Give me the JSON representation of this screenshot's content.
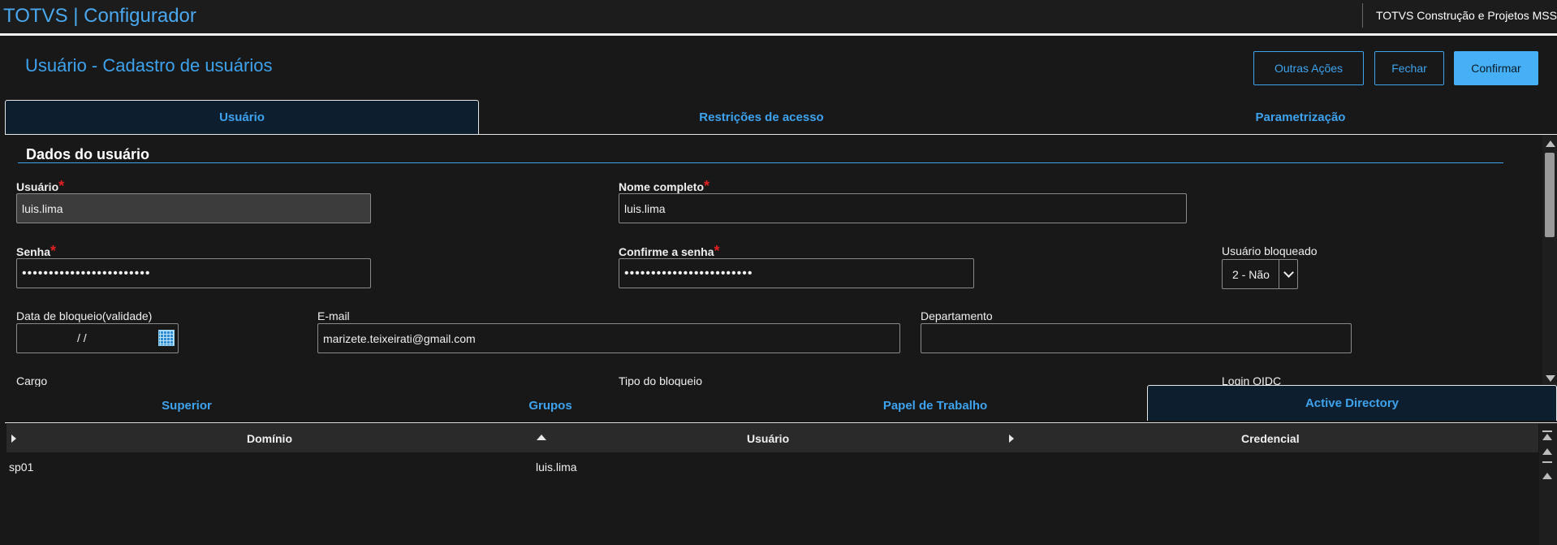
{
  "header": {
    "app_title": "TOTVS | Configurador",
    "company": "TOTVS Construção e Projetos MSS"
  },
  "page": {
    "title": "Usuário - Cadastro de usuários"
  },
  "actions": {
    "other_actions": "Outras Ações",
    "close": "Fechar",
    "confirm": "Confirmar"
  },
  "tabs": [
    {
      "label": "Usuário",
      "active": true
    },
    {
      "label": "Restrições de acesso",
      "active": false
    },
    {
      "label": "Parametrização",
      "active": false
    }
  ],
  "form": {
    "section_title": "Dados do usuário",
    "required_mark": "*",
    "user": {
      "label": "Usuário",
      "value": "luis.lima"
    },
    "full_name": {
      "label": "Nome completo",
      "value": "luis.lima"
    },
    "password": {
      "label": "Senha",
      "value": "••••••••••••••••••••••••"
    },
    "confirm_password": {
      "label": "Confirme a senha",
      "value": "••••••••••••••••••••••••"
    },
    "blocked": {
      "label": "Usuário bloqueado",
      "value": "2 - Não"
    },
    "block_date": {
      "label": "Data de bloqueio(validade)",
      "value": "/  /"
    },
    "email": {
      "label": "E-mail",
      "value": "marizete.teixeirati@gmail.com"
    },
    "department": {
      "label": "Departamento",
      "value": ""
    },
    "role": {
      "label": "Cargo"
    },
    "block_type": {
      "label": "Tipo do bloqueio"
    },
    "login_oidc": {
      "label": "Login OIDC"
    }
  },
  "subtabs": [
    {
      "label": "Superior",
      "active": false
    },
    {
      "label": "Grupos",
      "active": false
    },
    {
      "label": "Papel de Trabalho",
      "active": false
    },
    {
      "label": "Active Directory",
      "active": true
    }
  ],
  "grid": {
    "columns": [
      "Domínio",
      "Usuário",
      "Credencial"
    ],
    "rows": [
      {
        "domain": "sp01",
        "user": "luis.lima",
        "credential": ""
      }
    ]
  },
  "colors": {
    "accent": "#3ea3ee",
    "required": "#e02020",
    "background": "#181818"
  },
  "icons": [
    "calendar-icon",
    "chevron-down-icon",
    "sort-asc-icon",
    "expand-icon"
  ]
}
